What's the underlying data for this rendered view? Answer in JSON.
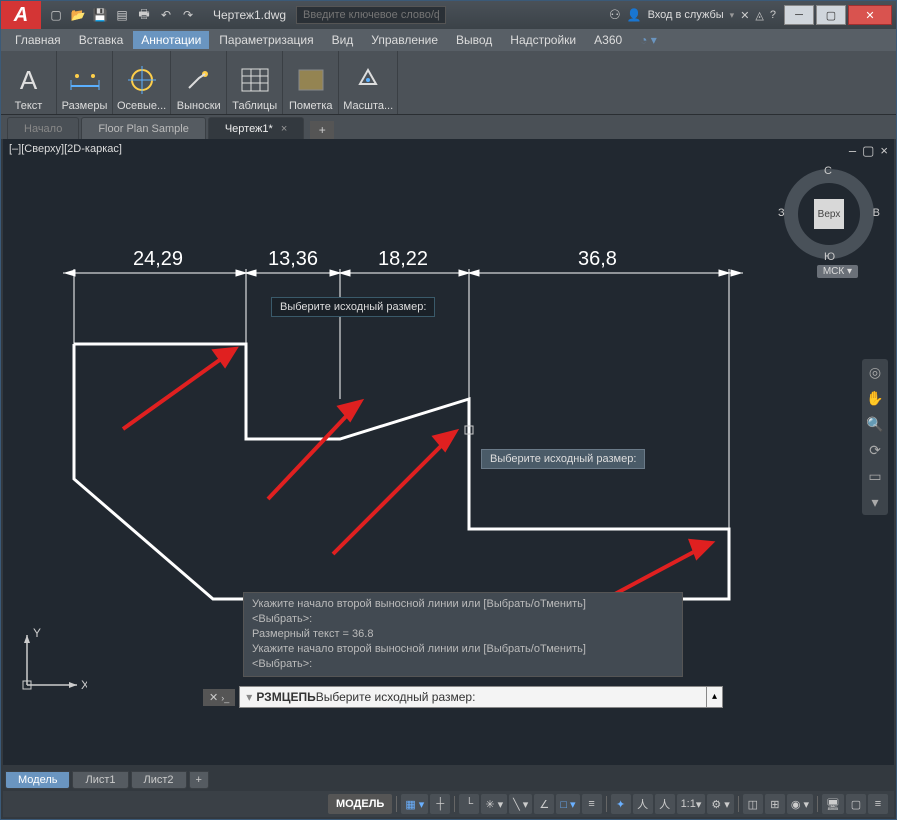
{
  "titlebar": {
    "filename": "Чертеж1.dwg",
    "search_placeholder": "Введите ключевое слово/фразу",
    "signin": "Вход в службы"
  },
  "menu": {
    "items": [
      "Главная",
      "Вставка",
      "Аннотации",
      "Параметризация",
      "Вид",
      "Управление",
      "Вывод",
      "Надстройки",
      "A360"
    ],
    "active_index": 2
  },
  "ribbon": {
    "groups": [
      {
        "label": "Текст",
        "icon": "A"
      },
      {
        "label": "Размеры",
        "icon": "dim"
      },
      {
        "label": "Осевые...",
        "icon": "center"
      },
      {
        "label": "Выноски",
        "icon": "leader"
      },
      {
        "label": "Таблицы",
        "icon": "table"
      },
      {
        "label": "Пометка",
        "icon": "mark"
      },
      {
        "label": "Масшта...",
        "icon": "scale"
      }
    ]
  },
  "filetabs": {
    "tabs": [
      {
        "label": "Начало",
        "kind": "start"
      },
      {
        "label": "Floor Plan Sample",
        "kind": "normal"
      },
      {
        "label": "Чертеж1*",
        "kind": "active"
      }
    ]
  },
  "viewport": {
    "label": "[–][Сверху][2D-каркас]"
  },
  "dimensions": {
    "d1": "24,29",
    "d2": "13,36",
    "d3": "18,22",
    "d4": "36,8"
  },
  "tooltip1": "Выберите исходный размер:",
  "tooltip2": "Выберите исходный размер:",
  "viewcube": {
    "face": "Верх",
    "n": "С",
    "s": "Ю",
    "e": "В",
    "w": "З",
    "mck": "МСК  ▾"
  },
  "cmdhist": {
    "l1": "Укажите начало второй выносной линии или [Выбрать/оТменить]",
    "l2": "<Выбрать>:",
    "l3": "Размерный текст = 36.8",
    "l4": "Укажите начало второй выносной линии или [Выбрать/оТменить]",
    "l5": "<Выбрать>:"
  },
  "cmdline": {
    "cmd": "РЗМЦЕПЬ",
    "prompt": " Выберите исходный размер:"
  },
  "ucs": {
    "x": "X",
    "y": "Y"
  },
  "layouttabs": {
    "tabs": [
      "Модель",
      "Лист1",
      "Лист2"
    ],
    "active_index": 0
  },
  "statusbar": {
    "model": "МОДЕЛЬ",
    "scale": "1:1"
  }
}
